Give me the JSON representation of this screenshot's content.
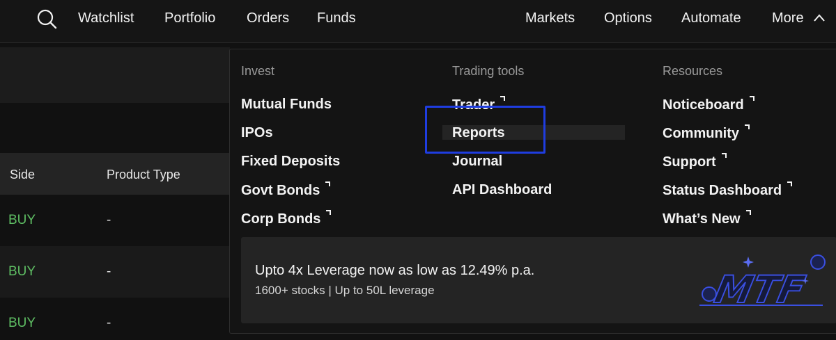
{
  "nav": {
    "left": [
      "Watchlist",
      "Portfolio",
      "Orders",
      "Funds"
    ],
    "right": [
      "Markets",
      "Options",
      "Automate",
      "More"
    ],
    "search_icon": "search-icon",
    "more_icon": "chevron-up-icon"
  },
  "table": {
    "headers": [
      "Side",
      "Product Type"
    ],
    "rows": [
      {
        "side": "BUY",
        "product_type": "-"
      },
      {
        "side": "BUY",
        "product_type": "-"
      },
      {
        "side": "BUY",
        "product_type": "-"
      }
    ]
  },
  "dropdown": {
    "columns": [
      {
        "heading": "Invest",
        "items": [
          {
            "label": "Mutual Funds",
            "external": false
          },
          {
            "label": "IPOs",
            "external": false
          },
          {
            "label": "Fixed Deposits",
            "external": false
          },
          {
            "label": "Govt Bonds",
            "external": true
          },
          {
            "label": "Corp Bonds",
            "external": true
          }
        ]
      },
      {
        "heading": "Trading tools",
        "items": [
          {
            "label": "Trader",
            "external": true
          },
          {
            "label": "Reports",
            "external": false
          },
          {
            "label": "Journal",
            "external": false
          },
          {
            "label": "API Dashboard",
            "external": false
          }
        ]
      },
      {
        "heading": "Resources",
        "items": [
          {
            "label": "Noticeboard",
            "external": true
          },
          {
            "label": "Community",
            "external": true
          },
          {
            "label": "Support",
            "external": true
          },
          {
            "label": "Status Dashboard",
            "external": true
          },
          {
            "label": "What’s New",
            "external": true
          }
        ]
      }
    ],
    "highlighted_item": "Reports",
    "banner": {
      "title": "Upto 4x Leverage now as low as 12.49% p.a.",
      "subtitle": "1600+ stocks | Up to 50L leverage",
      "art_label": "MTF"
    }
  },
  "colors": {
    "background": "#111111",
    "buy_green": "#5fbf64",
    "highlight_blue": "#1f3de0",
    "art_blue": "#3a4fe0"
  }
}
